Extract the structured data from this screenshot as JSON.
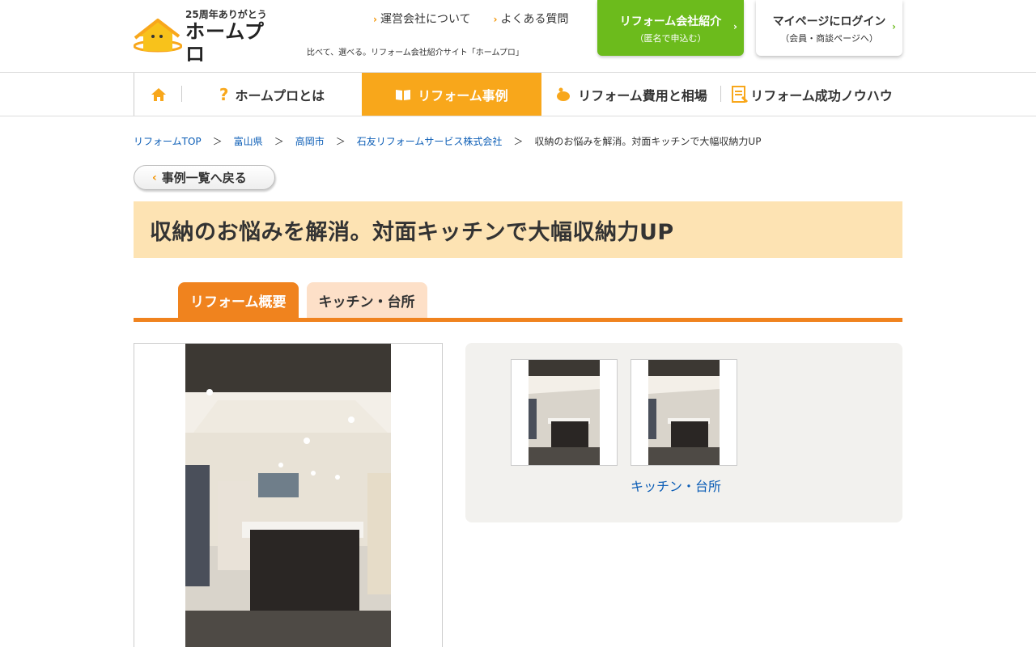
{
  "header": {
    "logo_anniversary": "25周年ありがとう",
    "logo_name": "ホームプロ",
    "tagline": "比べて、選べる。リフォーム会社紹介サイト「ホームプロ」",
    "top_links": [
      "運営会社について",
      "よくある質問"
    ],
    "cta_green": {
      "line1": "リフォーム会社紹介",
      "line2": "（匿名で申込む）"
    },
    "cta_login": {
      "line1": "マイページにログイン",
      "line2": "（会員・商談ページへ）"
    }
  },
  "nav": {
    "about": "ホームプロとは",
    "cases": "リフォーム事例",
    "cost": "リフォーム費用と相場",
    "knowhow": "リフォーム成功ノウハウ"
  },
  "breadcrumb": {
    "items": [
      "リフォームTOP",
      "富山県",
      "高岡市",
      "石友リフォームサービス株式会社"
    ],
    "separator": "＞",
    "current": "収納のお悩みを解消。対面キッチンで大幅収納力UP"
  },
  "back_button": "事例一覧へ戻る",
  "page_title": "収納のお悩みを解消。対面キッチンで大幅収納力UP",
  "tabs": {
    "active": "リフォーム概要",
    "other": "キッチン・台所"
  },
  "gallery": {
    "caption": "キッチン・台所"
  },
  "colors": {
    "accent_orange": "#f8a71b",
    "tab_orange": "#f0831e",
    "green": "#6cbb1c",
    "link": "#0b5db6"
  }
}
